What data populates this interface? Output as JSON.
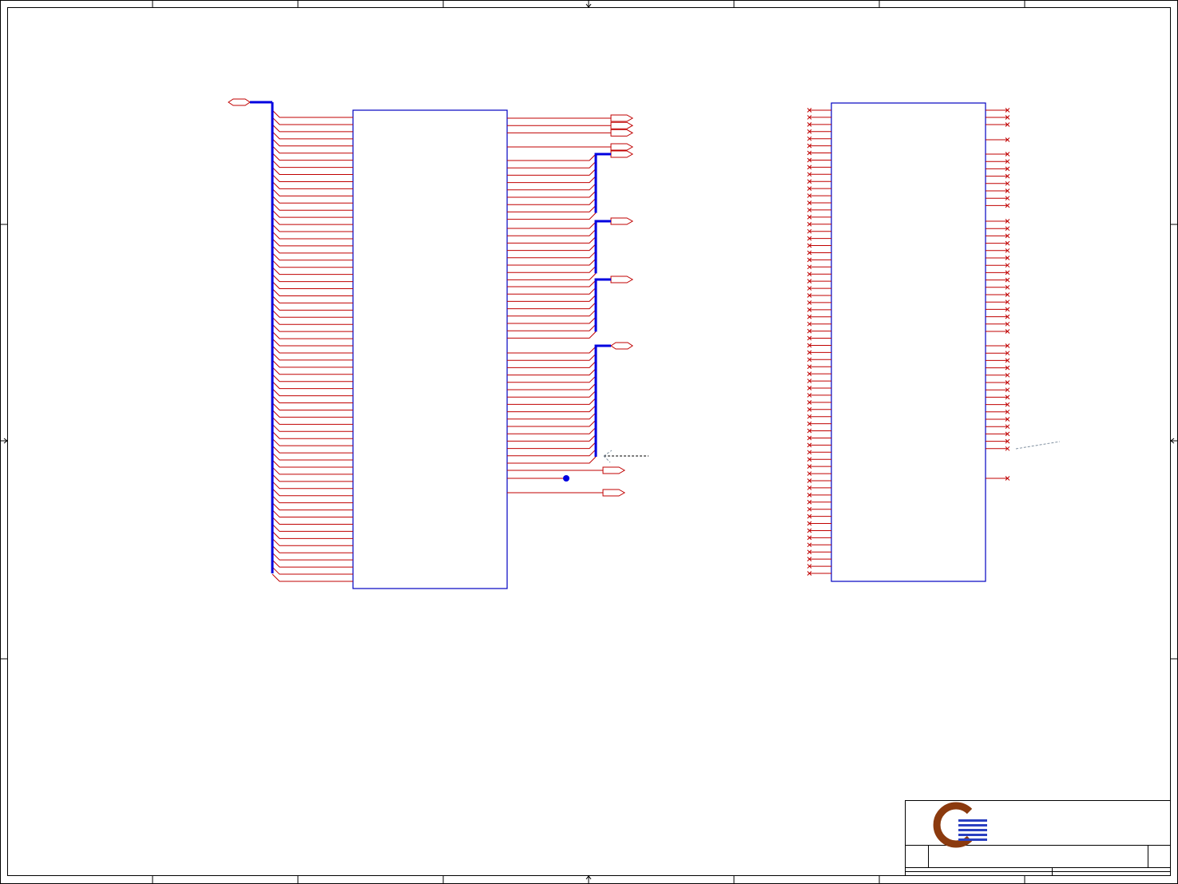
{
  "diagram": {
    "description_type": "schematic-sheet",
    "colors": {
      "wire": "#c00000",
      "bus": "#0000e0",
      "component_outline": "#0000c0",
      "frame": "#000000",
      "logo_ring": "#8b3a0e",
      "logo_bars": "#2a3fc0"
    },
    "left_component": {
      "left_pin_count": 66,
      "right_pin_groups": {
        "direct_outputs": 3,
        "bus_group_1": 9,
        "bus_group_2": 8,
        "bus_group_3": 8,
        "bus_group_4": 16,
        "bottom_outputs": 3
      }
    },
    "right_component": {
      "left_pin_count": 66,
      "right_pin_count": 44,
      "pins_no_connect": true
    },
    "title_block": {
      "logo": "company-logo"
    }
  }
}
